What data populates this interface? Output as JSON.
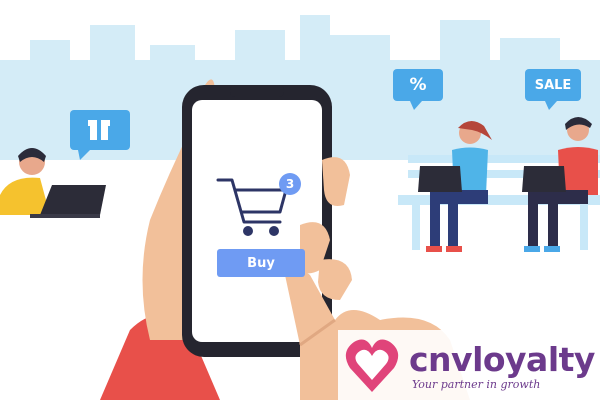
{
  "screen": {
    "cart_badge_count": "3",
    "buy_label": "Buy"
  },
  "bubbles": {
    "percent_label": "%",
    "sale_label": "SALE"
  },
  "logo": {
    "name": "cnvloyalty",
    "tagline": "Your partner in growth"
  },
  "colors": {
    "sky_buildings": "#c9e7f5",
    "accent_blue": "#6f9bf3",
    "bubble_blue": "#4aa8e8",
    "bench_blue": "#c8e8f8",
    "skin": "#f2c09a",
    "sleeve_red": "#e8504a",
    "brand_purple": "#6c3a8c",
    "brand_pink": "#e0447a"
  },
  "icons": [
    "gift-icon",
    "cart-icon",
    "heart-logo-icon"
  ]
}
